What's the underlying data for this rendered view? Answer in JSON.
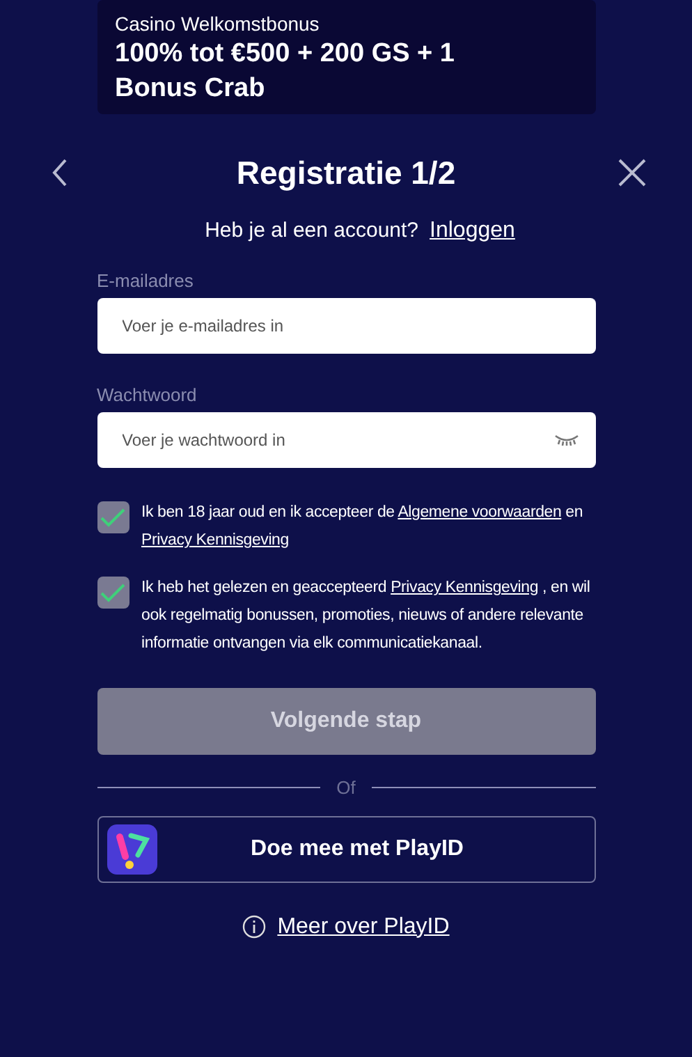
{
  "banner": {
    "subtitle": "Casino Welkomstbonus",
    "title": "100% tot €500 + 200 GS + 1 Bonus Crab"
  },
  "header": {
    "title": "Registratie 1/2"
  },
  "login_prompt": {
    "text": "Heb je al een account?",
    "link": "Inloggen"
  },
  "fields": [
    {
      "kind": "email",
      "label": "E-mailadres",
      "placeholder": "Voer je e-mailadres in"
    },
    {
      "kind": "password",
      "label": "Wachtwoord",
      "placeholder": "Voer je wachtwoord in"
    }
  ],
  "consents": [
    {
      "checked": true,
      "parts": [
        {
          "kind": "text",
          "text": "Ik ben 18 jaar oud en ik accepteer de "
        },
        {
          "kind": "link",
          "text": "Algemene voorwaarden"
        },
        {
          "kind": "text",
          "text": " en "
        },
        {
          "kind": "link",
          "text": "Privacy Kennisgeving"
        }
      ]
    },
    {
      "checked": true,
      "parts": [
        {
          "kind": "text",
          "text": "Ik heb het gelezen en geaccepteerd "
        },
        {
          "kind": "link",
          "text": "Privacy Kennisgeving"
        },
        {
          "kind": "text",
          "text": " , en wil ook regelmatig bonussen, promoties, nieuws of andere relevante informatie ontvangen via elk communicatiekanaal."
        }
      ]
    }
  ],
  "next_button": {
    "label": "Volgende stap",
    "disabled": true
  },
  "divider": "Of",
  "playid_button": "Doe mee met PlayID",
  "more_link": "Meer over PlayID"
}
